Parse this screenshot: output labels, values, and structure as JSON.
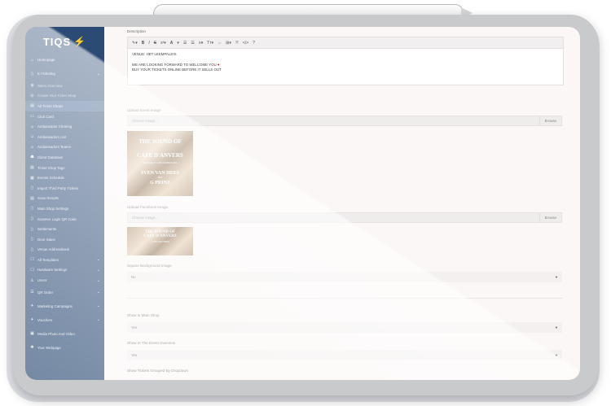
{
  "app": {
    "logo": "TIQS"
  },
  "sidebar": {
    "top_items": [
      {
        "label": "Homepage",
        "icon": "home-icon"
      },
      {
        "label": "E-Ticketing",
        "icon": "ticket-icon"
      }
    ],
    "sub_items": [
      {
        "label": "Sales Overview"
      },
      {
        "label": "Create Your Ticket Shop"
      },
      {
        "label": "All Ticket Shops"
      },
      {
        "label": "Club Card"
      },
      {
        "label": "Ambassador Clearing"
      },
      {
        "label": "Ambassadors List"
      },
      {
        "label": "Ambassadors Teams"
      },
      {
        "label": "Client Database"
      },
      {
        "label": "Ticket Shop Tags"
      },
      {
        "label": "Events Schedule"
      },
      {
        "label": "Import Third Party Tickets"
      },
      {
        "label": "Scan Results"
      },
      {
        "label": "Main Shop Settings"
      },
      {
        "label": "Scanner Login QR Code"
      },
      {
        "label": "Settlements"
      },
      {
        "label": "Door Sales"
      },
      {
        "label": "Venue Addressbook"
      },
      {
        "label": "All Templates"
      },
      {
        "label": "Hardware Settings"
      },
      {
        "label": "Users"
      }
    ],
    "bottom_items": [
      {
        "label": "QR Order"
      },
      {
        "label": "Marketing Campaigns"
      },
      {
        "label": "Vouchers"
      },
      {
        "label": "Media Photo And Video"
      },
      {
        "label": "Your Webpage"
      }
    ]
  },
  "main": {
    "description": {
      "label": "Description",
      "toolbar": [
        "✎▾",
        "B",
        "I",
        "S",
        "x²▾",
        "A",
        "▾",
        "☰",
        "☰",
        "≡▾",
        "Tт▾",
        "⇔",
        "⊞▾",
        "⤧",
        "</>",
        "?"
      ],
      "line1": "VENUE: HET LEEMPALEIS",
      "line2": "WE ARE LOOKING FORWARD TO WELCOME YOU",
      "line3": "BUY YOUR TICKETS ONLINE BEFORE IT SELLS OUT"
    },
    "upload_event_image": {
      "label": "Upload Event Image",
      "placeholder": "Choose image...",
      "browse": "Browse"
    },
    "event_poster": {
      "line1": "THE SOUND OF",
      "line2": "CAFE D'ANVERS",
      "line3": "SATURDAY 1 DECEMBER 2023",
      "line4": "SVEN VAN HEES",
      "line5": "B2B",
      "line6": "G PRINZ"
    },
    "upload_facebook_image": {
      "label": "Upload Facebook Image",
      "placeholder": "Choose image...",
      "browse": "Browse"
    },
    "fb_poster": {
      "line1": "THE SOUND OF",
      "line2": "CAFE D'ANVERS",
      "line3": "SVEN VAN HEES"
    },
    "square_background": {
      "label": "Square Background Image",
      "value": "No"
    },
    "show_main_shop": {
      "label": "Show in Main Shop",
      "value": "Yes"
    },
    "show_event_overview": {
      "label": "Show In The Event Overview",
      "value": "Yes"
    },
    "show_grouped": {
      "label": "Show Tickets Grouped By Dropdown"
    }
  }
}
